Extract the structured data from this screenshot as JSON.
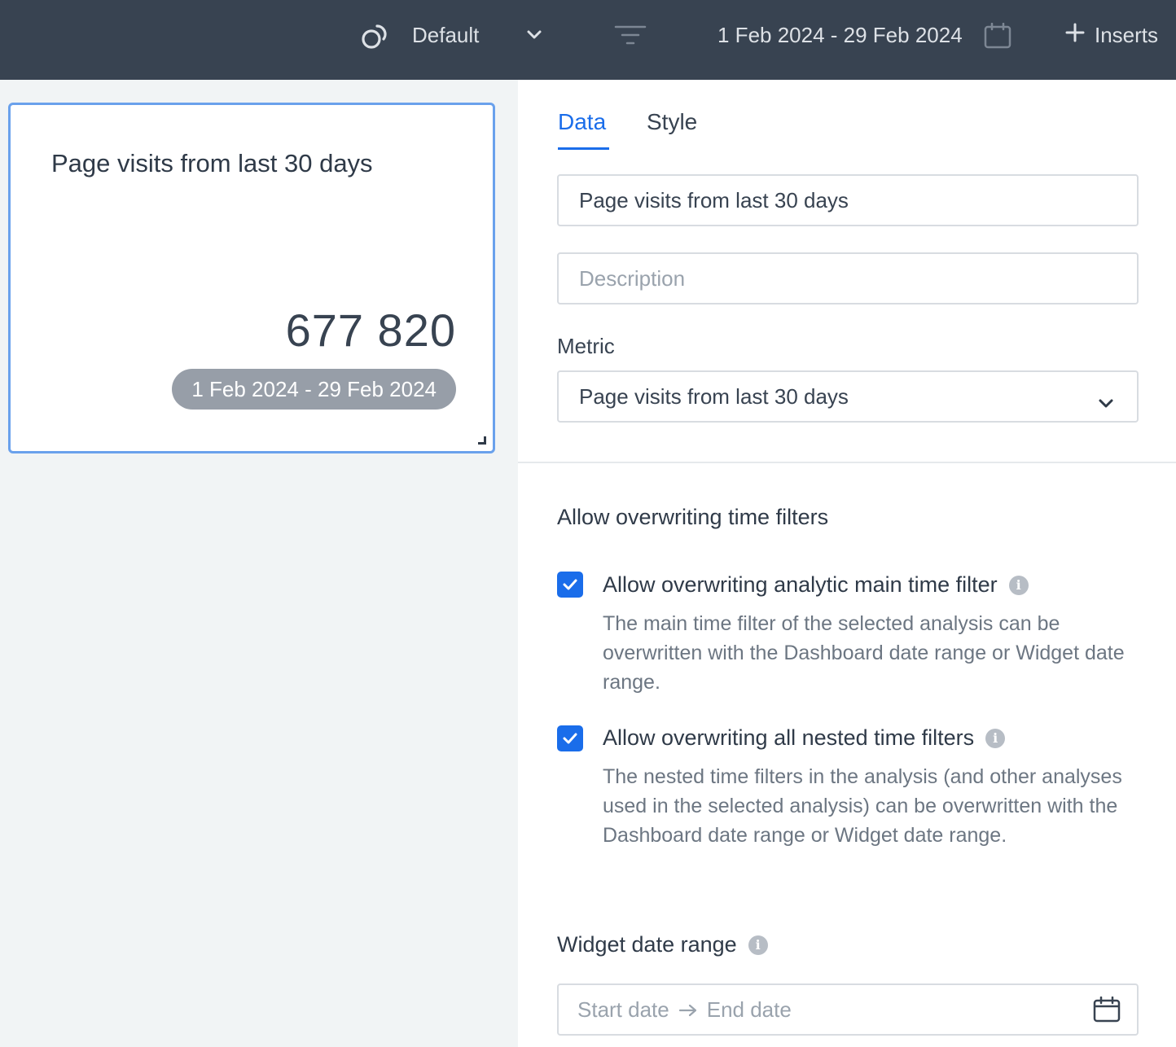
{
  "topbar": {
    "view_label": "Default",
    "date_range": "1 Feb 2024 - 29 Feb 2024",
    "inserts_label": "Inserts"
  },
  "widget": {
    "title": "Page visits from last 30 days",
    "value": "677 820",
    "date_range": "1 Feb 2024 - 29 Feb 2024"
  },
  "panel": {
    "tabs": [
      {
        "label": "Data",
        "active": true
      },
      {
        "label": "Style",
        "active": false
      }
    ],
    "name_value": "Page visits from last 30 days",
    "description_placeholder": "Description",
    "metric_label": "Metric",
    "metric_value": "Page visits from last 30 days",
    "time_filters": {
      "title": "Allow overwriting time filters",
      "options": [
        {
          "label": "Allow overwriting analytic main time filter",
          "checked": true,
          "description": "The main time filter of the selected analysis can be overwritten with the Dashboard date range or Widget date range."
        },
        {
          "label": "Allow overwriting all nested time filters",
          "checked": true,
          "description": "The nested time filters in the analysis (and other analyses used in the selected analysis) can be overwritten with the Dashboard date range or Widget date range."
        }
      ]
    },
    "widget_date_range": {
      "title": "Widget date range",
      "start_placeholder": "Start date",
      "end_placeholder": "End date"
    }
  },
  "colors": {
    "topbar_bg": "#384351",
    "accent": "#1a6dea",
    "widget_border": "#6aa1ec",
    "pill_bg": "#979ea8"
  }
}
